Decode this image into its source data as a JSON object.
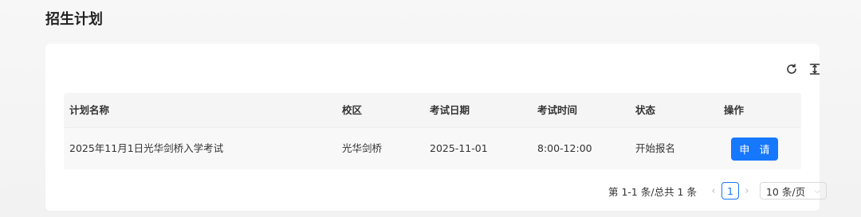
{
  "page": {
    "title": "招生计划"
  },
  "toolbar": {
    "refresh_icon": "refresh-icon",
    "density_icon": "column-height-icon"
  },
  "table": {
    "columns": [
      "计划名称",
      "校区",
      "考试日期",
      "考试时间",
      "状态",
      "操作"
    ],
    "rows": [
      {
        "name": "2025年11月1日光华剑桥入学考试",
        "campus": "光华剑桥",
        "exam_date": "2025-11-01",
        "exam_time": "8:00-12:00",
        "status": "开始报名",
        "action": "申 请"
      }
    ]
  },
  "pagination": {
    "total_text": "第 1-1 条/总共 1 条",
    "prev": "‹",
    "current_page": "1",
    "next": "›",
    "page_size": "10 条/页",
    "page_size_chevron": "⌵"
  },
  "colors": {
    "primary": "#1677ff",
    "header_bg": "#f5f5f5",
    "row_bg": "#f8f8f8"
  }
}
